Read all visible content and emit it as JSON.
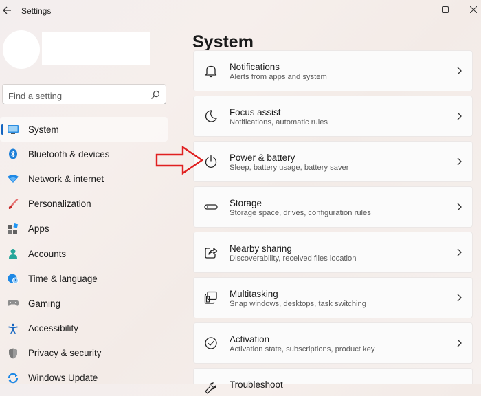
{
  "window": {
    "title": "Settings"
  },
  "search": {
    "placeholder": "Find a setting"
  },
  "sidebar": {
    "items": [
      {
        "label": "System",
        "icon": "monitor-icon",
        "selected": true
      },
      {
        "label": "Bluetooth & devices",
        "icon": "bluetooth-icon"
      },
      {
        "label": "Network & internet",
        "icon": "wifi-icon"
      },
      {
        "label": "Personalization",
        "icon": "brush-icon"
      },
      {
        "label": "Apps",
        "icon": "apps-icon"
      },
      {
        "label": "Accounts",
        "icon": "person-icon"
      },
      {
        "label": "Time & language",
        "icon": "globe-clock-icon"
      },
      {
        "label": "Gaming",
        "icon": "controller-icon"
      },
      {
        "label": "Accessibility",
        "icon": "accessibility-icon"
      },
      {
        "label": "Privacy & security",
        "icon": "shield-icon"
      },
      {
        "label": "Windows Update",
        "icon": "update-icon"
      }
    ]
  },
  "main": {
    "title": "System",
    "cards": [
      {
        "title": "Notifications",
        "subtitle": "Alerts from apps and system",
        "icon": "bell-icon"
      },
      {
        "title": "Focus assist",
        "subtitle": "Notifications, automatic rules",
        "icon": "moon-icon"
      },
      {
        "title": "Power & battery",
        "subtitle": "Sleep, battery usage, battery saver",
        "icon": "power-icon"
      },
      {
        "title": "Storage",
        "subtitle": "Storage space, drives, configuration rules",
        "icon": "drive-icon"
      },
      {
        "title": "Nearby sharing",
        "subtitle": "Discoverability, received files location",
        "icon": "share-icon"
      },
      {
        "title": "Multitasking",
        "subtitle": "Snap windows, desktops, task switching",
        "icon": "multitask-icon"
      },
      {
        "title": "Activation",
        "subtitle": "Activation state, subscriptions, product key",
        "icon": "check-circle-icon"
      },
      {
        "title": "Troubleshoot",
        "subtitle": "",
        "icon": "wrench-icon"
      }
    ]
  },
  "colors": {
    "accent": "#1565c0",
    "annotation_arrow": "#e02020"
  }
}
